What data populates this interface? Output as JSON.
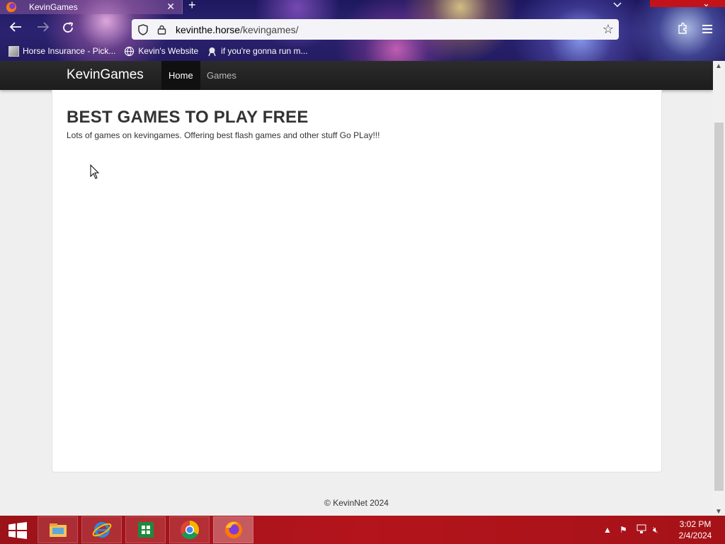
{
  "browser": {
    "tab_title": "KevinGames",
    "tab_close": "✕",
    "new_tab": "+",
    "url_host": "kevinthe.horse",
    "url_path": "/kevingames/",
    "bookmarks": [
      {
        "label": "Horse Insurance - Pick..."
      },
      {
        "label": "Kevin's Website"
      },
      {
        "label": "if you're gonna run m..."
      }
    ]
  },
  "site": {
    "brand": "KevinGames",
    "nav": [
      {
        "label": "Home",
        "active": true
      },
      {
        "label": "Games",
        "active": false
      }
    ],
    "headline": "BEST GAMES TO PLAY FREE",
    "tagline": "Lots of games on kevingames. Offering best flash games and other stuff Go PLay!!!",
    "footer": "© KevinNet 2024"
  },
  "taskbar": {
    "apps": [
      "file-explorer",
      "internet-explorer",
      "store",
      "chrome",
      "firefox"
    ],
    "active_app": "firefox",
    "time": "3:02 PM",
    "date": "2/4/2024"
  },
  "colors": {
    "navbar": "#222222",
    "taskbar": "#ab1319",
    "page_bg": "#efefef"
  }
}
